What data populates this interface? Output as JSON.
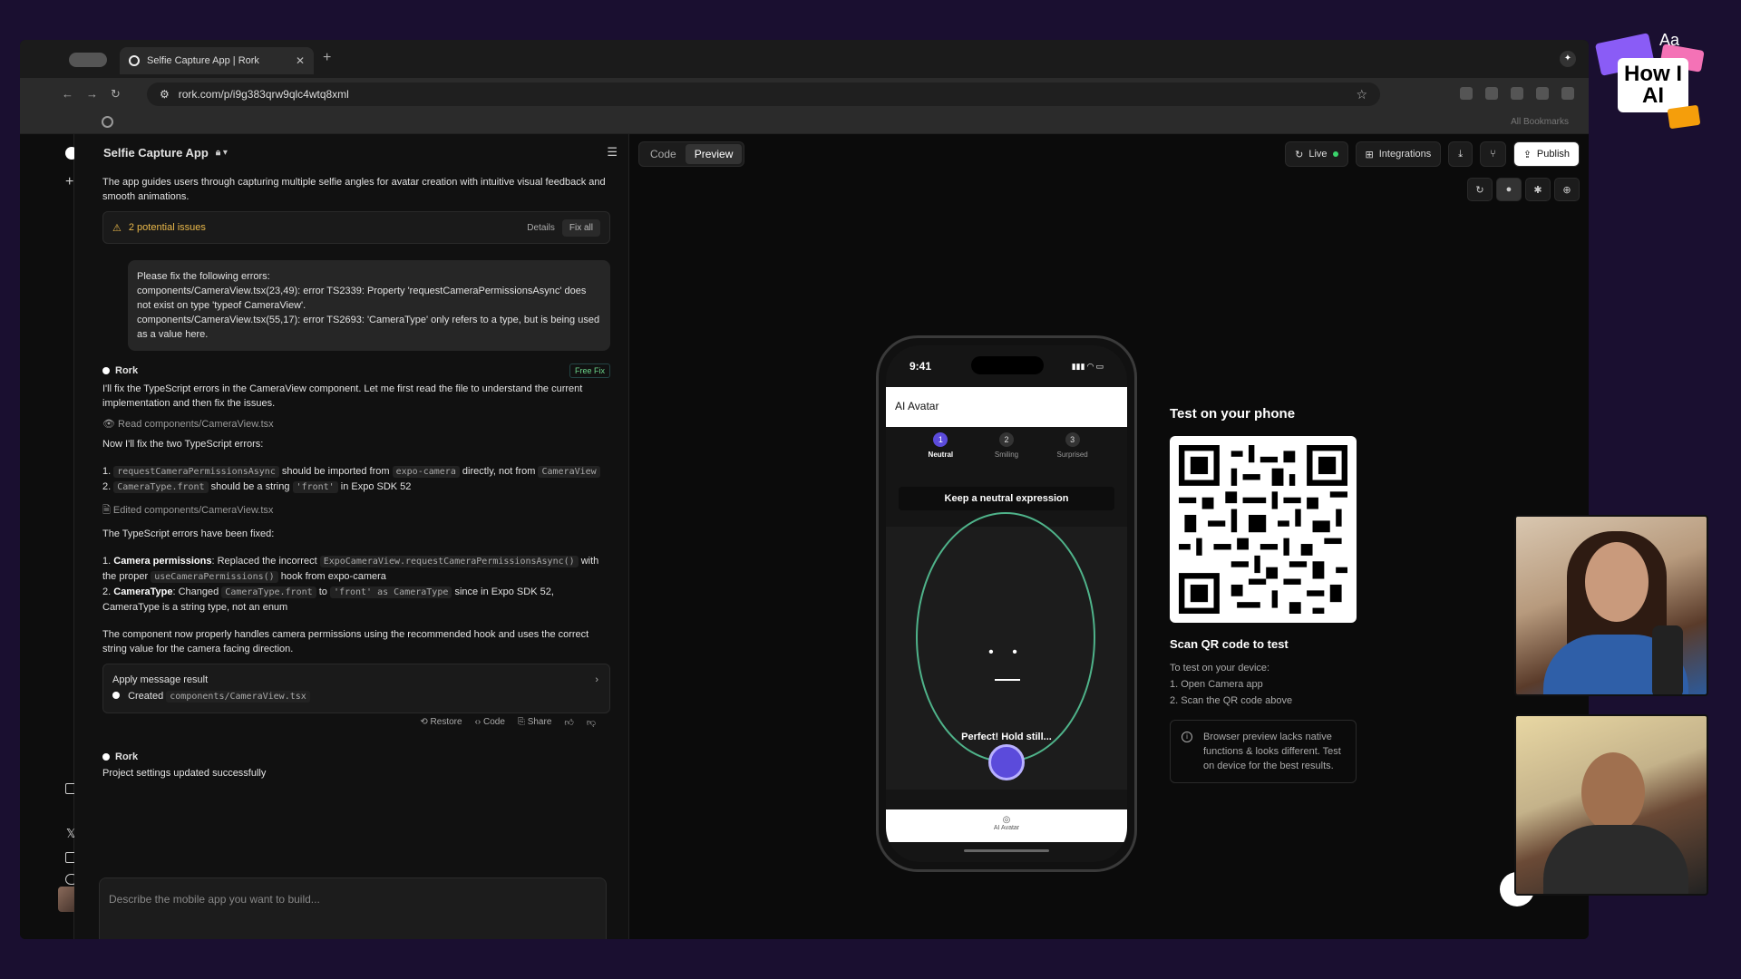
{
  "browser": {
    "tab_title": "Selfie Capture App | Rork",
    "url": "rork.com/p/i9g383qrw9qlc4wtq8xml",
    "bookmarks_label": "All Bookmarks"
  },
  "chat": {
    "project_title": "Selfie Capture App",
    "intro": "The app guides users through capturing multiple selfie angles for avatar creation with intuitive visual feedback and smooth animations.",
    "issues": {
      "label": "2 potential issues",
      "details": "Details",
      "fix_all": "Fix all"
    },
    "user_message": {
      "line1": "Please fix the following errors:",
      "line2": "components/CameraView.tsx(23,49): error TS2339: Property 'requestCameraPermissionsAsync' does not exist on type 'typeof CameraView'.",
      "line3": "components/CameraView.tsx(55,17): error TS2693: 'CameraType' only refers to a type, but is being used as a value here."
    },
    "rork_name": "Rork",
    "free_fix": "Free Fix",
    "reply1": "I'll fix the TypeScript errors in the CameraView component. Let me first read the file to understand the current implementation and then fix the issues.",
    "read_file": "Read components/CameraView.tsx",
    "fix_two": "Now I'll fix the two TypeScript errors:",
    "item1": {
      "num": "1.",
      "code_a": "requestCameraPermissionsAsync",
      "t1": "should be imported from",
      "code_b": "expo-camera",
      "t2": "directly, not from",
      "code_c": "CameraView",
      "t3": "2.",
      "code_d": "CameraType.front",
      "t4": "should be a string",
      "code_e": "'front'",
      "t5": "in Expo SDK 52"
    },
    "edited_file": "Edited components/CameraView.tsx",
    "fixed_heading": "The TypeScript errors have been fixed:",
    "fix1": {
      "num": "1.",
      "bold": "Camera permissions",
      "t1": ": Replaced the incorrect",
      "code_a": "ExpoCameraView.requestCameraPermissionsAsync()",
      "t2": "with the proper",
      "code_b": "useCameraPermissions()",
      "t3": "hook from expo-camera"
    },
    "fix2": {
      "num": "2.",
      "bold": "CameraType",
      "t1": ": Changed",
      "code_a": "CameraType.front",
      "t2": "to",
      "code_b": "'front' as CameraType",
      "t3": "since in Expo SDK 52, CameraType is a string type, not an enum"
    },
    "summary": "The component now properly handles camera permissions using the recommended hook and uses the correct string value for the camera facing direction.",
    "apply": {
      "title": "Apply message result",
      "created": "Created",
      "file": "components/CameraView.tsx"
    },
    "actions": {
      "restore": "Restore",
      "code": "Code",
      "share": "Share"
    },
    "settings_msg": "Project settings updated successfully",
    "input_placeholder": "Describe the mobile app you want to build..."
  },
  "preview": {
    "tabs": [
      "Code",
      "Preview"
    ],
    "live": "Live",
    "integrations": "Integrations",
    "publish": "Publish",
    "phone": {
      "time": "9:41",
      "app_title": "AI Avatar",
      "steps": [
        {
          "num": "1",
          "label": "Neutral"
        },
        {
          "num": "2",
          "label": "Smiling"
        },
        {
          "num": "3",
          "label": "Surprised"
        }
      ],
      "instruction": "Keep a neutral expression",
      "status": "Perfect! Hold still...",
      "tab_label": "AI Avatar"
    },
    "qr": {
      "title": "Test on your phone",
      "subtitle": "Scan QR code to test",
      "instructions": [
        "To test on your device:",
        "1. Open Camera app",
        "2. Scan the QR code above"
      ],
      "note": "Browser preview lacks native functions & looks different. Test on device for the best results."
    }
  },
  "overlay": {
    "badge_aa": "Aa",
    "badge_text": "How I AI"
  },
  "colors": {
    "accent": "#5b4bdb",
    "live_dot": "#3ad36b",
    "warning": "#e9b84a",
    "oval": "#4fb38a"
  }
}
